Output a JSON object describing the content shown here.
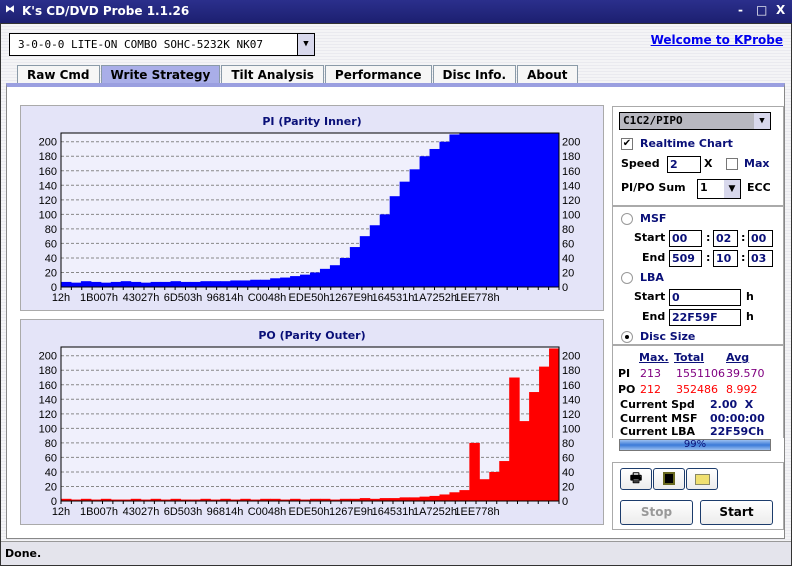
{
  "window": {
    "title": "K's CD/DVD Probe 1.1.26",
    "minimize": "-",
    "maximize": "□",
    "close": "X"
  },
  "drive": {
    "selected": "3-0-0-0 LITE-ON COMBO SOHC-5232K NK07"
  },
  "welcome_link": "Welcome to KProbe",
  "tabs": [
    {
      "label": "Raw Cmd"
    },
    {
      "label": "Write Strategy"
    },
    {
      "label": "Tilt Analysis"
    },
    {
      "label": "Performance"
    },
    {
      "label": "Disc Info."
    },
    {
      "label": "About"
    }
  ],
  "active_tab": "Write Strategy",
  "side": {
    "mode": "C1C2/PIPO",
    "realtime_label": "Realtime Chart",
    "realtime_checked": true,
    "speed_label": "Speed",
    "speed_value": "2",
    "speed_unit": "X",
    "max_label": "Max",
    "max_checked": false,
    "sum_label": "PI/PO Sum",
    "sum_value": "1",
    "ecc_label": "ECC",
    "msf_label": "MSF",
    "start_label": "Start",
    "end_label": "End",
    "msf_start": [
      "00",
      "02",
      "00"
    ],
    "msf_end": [
      "509",
      "10",
      "03"
    ],
    "lba_label": "LBA",
    "lba_start": "0",
    "lba_end": "22F59F",
    "h": "h",
    "disc_size_label": "Disc Size",
    "selected_range": "Disc Size"
  },
  "stats": {
    "headers": [
      "Max.",
      "Total",
      "Avg"
    ],
    "pi": {
      "label": "PI",
      "max": "213",
      "total": "1551106",
      "avg": "39.570"
    },
    "po": {
      "label": "PO",
      "max": "212",
      "total": "352486",
      "avg": "8.992"
    },
    "current_spd_label": "Current Spd",
    "current_spd": "2.00  X",
    "current_msf_label": "Current MSF",
    "current_msf": "00:00:00",
    "current_lba_label": "Current LBA",
    "current_lba": "22F59Ch",
    "progress_text": "99%",
    "progress": 0.99
  },
  "buttons": {
    "print": "printer-icon",
    "save": "floppy-icon",
    "open": "folder-icon",
    "stop": "Stop",
    "start": "Start"
  },
  "status": "Done.",
  "chart_data": [
    {
      "type": "bar",
      "title": "PI (Parity Inner)",
      "color": "#0000ff",
      "ylim": [
        0,
        212
      ],
      "yticks": [
        0,
        20,
        40,
        60,
        80,
        100,
        120,
        140,
        160,
        180,
        200
      ],
      "grid": true,
      "xticks": [
        "12h",
        "1B007h",
        "43027h",
        "6D503h",
        "96814h",
        "C0048h",
        "EDE50h",
        "1267E9h",
        "164531h",
        "1A7252h",
        "1EE778h"
      ],
      "values": [
        7,
        6,
        8,
        7,
        6,
        7,
        8,
        7,
        6,
        7,
        7,
        8,
        7,
        7,
        8,
        8,
        8,
        9,
        9,
        10,
        10,
        12,
        13,
        15,
        17,
        20,
        25,
        30,
        40,
        55,
        70,
        85,
        100,
        125,
        145,
        162,
        180,
        190,
        200,
        210,
        212,
        212,
        212,
        212,
        212,
        212,
        212,
        212,
        212,
        212
      ]
    },
    {
      "type": "bar",
      "title": "PO (Parity Outer)",
      "color": "#ff0000",
      "ylim": [
        0,
        212
      ],
      "yticks": [
        0,
        20,
        40,
        60,
        80,
        100,
        120,
        140,
        160,
        180,
        200
      ],
      "grid": true,
      "xticks": [
        "12h",
        "1B007h",
        "43027h",
        "6D503h",
        "96814h",
        "C0048h",
        "EDE50h",
        "1267E9h",
        "164531h",
        "1A7252h",
        "1EE778h"
      ],
      "values": [
        3,
        2,
        3,
        2,
        3,
        2,
        2,
        3,
        2,
        3,
        2,
        3,
        2,
        2,
        3,
        2,
        3,
        2,
        3,
        2,
        3,
        3,
        2,
        3,
        2,
        3,
        3,
        2,
        3,
        3,
        4,
        3,
        4,
        4,
        5,
        5,
        6,
        7,
        9,
        12,
        15,
        80,
        30,
        40,
        55,
        170,
        110,
        150,
        185,
        210
      ]
    }
  ]
}
